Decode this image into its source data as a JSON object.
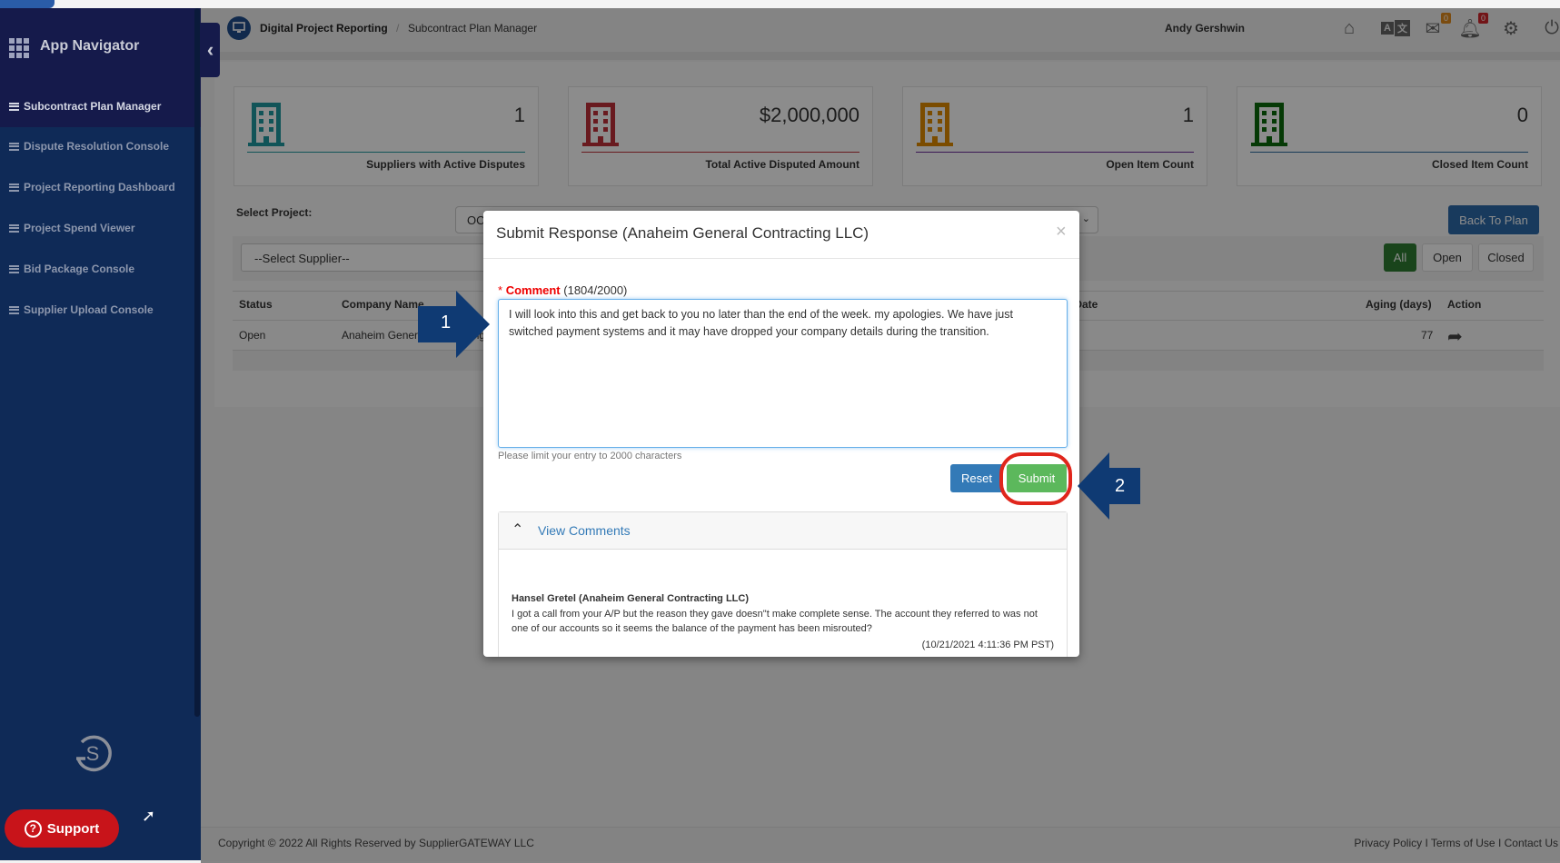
{
  "sidebar": {
    "title": "App Navigator",
    "items": [
      {
        "label": "Subcontract Plan Manager",
        "active": true
      },
      {
        "label": "Dispute Resolution Console"
      },
      {
        "label": "Project Reporting Dashboard"
      },
      {
        "label": "Project Spend Viewer"
      },
      {
        "label": "Bid Package Console"
      },
      {
        "label": "Supplier Upload Console"
      }
    ],
    "support_label": "Support"
  },
  "header": {
    "breadcrumb": [
      "Digital Project Reporting",
      "Subcontract Plan Manager"
    ],
    "separator": "/",
    "user": "Andy Gershwin",
    "mail_count": "0",
    "notification_count": "0"
  },
  "cards": [
    {
      "value": "1",
      "label": "Suppliers with Active Disputes",
      "color": "#1f9aa0"
    },
    {
      "value": "$2,000,000",
      "label": "Total Active Disputed Amount",
      "color": "#c0303a"
    },
    {
      "value": "1",
      "label": "Open Item Count",
      "color": "#e08a00"
    },
    {
      "value": "0",
      "label": "Closed Item Count",
      "color": "#0b6b0b"
    }
  ],
  "filters": {
    "project_label": "Select Project:",
    "project_value": "OC",
    "supplier_placeholder": "--Select Supplier--",
    "back_label": "Back To Plan",
    "status_buttons": [
      "All",
      "Open",
      "Closed"
    ],
    "active_status": "All"
  },
  "table": {
    "columns": [
      "Status",
      "Company Name",
      "Dispute Date",
      "Aging (days)",
      "Action"
    ],
    "rows": [
      {
        "status": "Open",
        "company": "Anaheim General Contracting LLC",
        "aging": "77"
      }
    ]
  },
  "footer": {
    "copyright": "Copyright © 2022 All Rights Reserved by SupplierGATEWAY LLC",
    "links": [
      "Privacy Policy",
      "Terms of Use",
      "Contact Us"
    ],
    "link_separator": "I"
  },
  "modal": {
    "title": "Submit Response (Anaheim General Contracting LLC)",
    "close": "×",
    "required_mark": "*",
    "comment_label": "Comment",
    "comment_count": "(1804/2000)",
    "comment_value": "I will look into this and get back to you no later than the end of the week. my apologies. We have just switched payment systems and it may have dropped your company details during the transition.",
    "hint": "Please limit your entry to 2000 characters",
    "reset_label": "Reset",
    "submit_label": "Submit",
    "view_comments_label": "View Comments",
    "comments": [
      {
        "author": "Hansel Gretel (Anaheim General Contracting LLC)",
        "text": "I got a call from your A/P but the reason they gave doesn\"t make complete sense. The account they referred to was not one of our accounts so it seems the balance of the payment has been misrouted?",
        "timestamp": "(10/21/2021 4:11:36 PM PST)"
      }
    ]
  },
  "annotations": {
    "step1": "1",
    "step2": "2",
    "arrow_color": "#0f3a73",
    "highlight_color": "#e0261c"
  }
}
